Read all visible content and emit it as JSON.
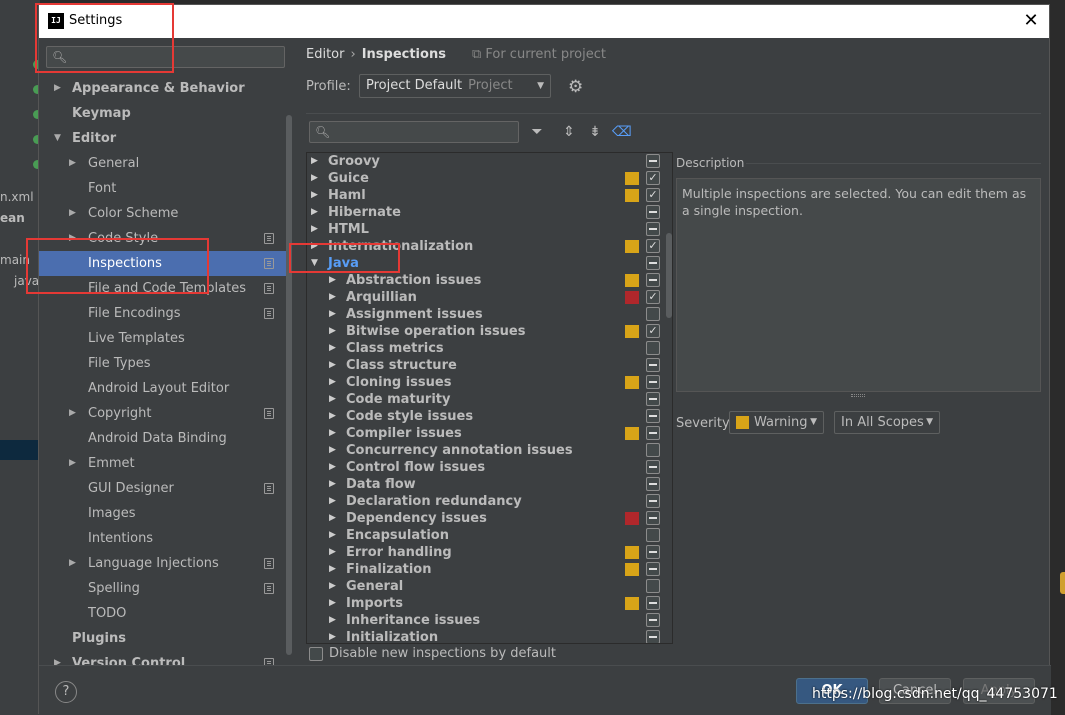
{
  "background_ide": {
    "texts": [
      "n.xml",
      "ean",
      "main",
      "java"
    ]
  },
  "window": {
    "title": "Settings",
    "app_icon_text": "IJ",
    "close_glyph": "✕"
  },
  "search": {
    "placeholder": "",
    "icon_glyph": "🔍︎"
  },
  "sidebar": {
    "items": [
      {
        "label": "Appearance & Behavior",
        "arrow": "▶"
      },
      {
        "label": "Keymap",
        "arrow": ""
      },
      {
        "label": "Editor",
        "arrow": "▼"
      },
      {
        "label": "General",
        "arrow": "▶"
      },
      {
        "label": "Font",
        "arrow": ""
      },
      {
        "label": "Color Scheme",
        "arrow": "▶"
      },
      {
        "label": "Code Style",
        "arrow": "▶"
      },
      {
        "label": "Inspections",
        "arrow": ""
      },
      {
        "label": "File and Code Templates",
        "arrow": ""
      },
      {
        "label": "File Encodings",
        "arrow": ""
      },
      {
        "label": "Live Templates",
        "arrow": ""
      },
      {
        "label": "File Types",
        "arrow": ""
      },
      {
        "label": "Android Layout Editor",
        "arrow": ""
      },
      {
        "label": "Copyright",
        "arrow": "▶"
      },
      {
        "label": "Android Data Binding",
        "arrow": ""
      },
      {
        "label": "Emmet",
        "arrow": "▶"
      },
      {
        "label": "GUI Designer",
        "arrow": ""
      },
      {
        "label": "Images",
        "arrow": ""
      },
      {
        "label": "Intentions",
        "arrow": ""
      },
      {
        "label": "Language Injections",
        "arrow": "▶"
      },
      {
        "label": "Spelling",
        "arrow": ""
      },
      {
        "label": "TODO",
        "arrow": ""
      },
      {
        "label": "Plugins",
        "arrow": ""
      },
      {
        "label": "Version Control",
        "arrow": "▶"
      }
    ]
  },
  "header": {
    "breadcrumb_parent": "Editor",
    "breadcrumb_sep": "›",
    "breadcrumb_current": "Inspections",
    "project_hint": "⧉ For current project",
    "profile_label": "Profile:",
    "profile_value": "Project Default",
    "profile_sub": "Project",
    "dropdown_glyph": "▼",
    "gear_glyph": "⚙"
  },
  "toolbar": {
    "filter_glyph": "⏷",
    "expand_glyph": "⇕",
    "collapse_glyph": "⇟",
    "eraser_glyph": "⌫"
  },
  "inspections": {
    "items": [
      {
        "label": "Groovy",
        "arrow": "▶",
        "severity": "",
        "check": "indet"
      },
      {
        "label": "Guice",
        "arrow": "▶",
        "severity": "#d8a418",
        "check": "checked"
      },
      {
        "label": "Haml",
        "arrow": "▶",
        "severity": "#d8a418",
        "check": "checked"
      },
      {
        "label": "Hibernate",
        "arrow": "▶",
        "severity": "",
        "check": "indet"
      },
      {
        "label": "HTML",
        "arrow": "▶",
        "severity": "",
        "check": "indet"
      },
      {
        "label": "Internationalization",
        "arrow": "▶",
        "severity": "#d8a418",
        "check": "checked"
      },
      {
        "label": "Java",
        "arrow": "▼",
        "severity": "",
        "check": "indet"
      },
      {
        "label": "Abstraction issues",
        "arrow": "▶",
        "severity": "#d8a418",
        "check": "indet"
      },
      {
        "label": "Arquillian",
        "arrow": "▶",
        "severity": "#b0272b",
        "check": "checked"
      },
      {
        "label": "Assignment issues",
        "arrow": "▶",
        "severity": "",
        "check": "empty"
      },
      {
        "label": "Bitwise operation issues",
        "arrow": "▶",
        "severity": "#d8a418",
        "check": "checked"
      },
      {
        "label": "Class metrics",
        "arrow": "▶",
        "severity": "",
        "check": "empty"
      },
      {
        "label": "Class structure",
        "arrow": "▶",
        "severity": "",
        "check": "indet"
      },
      {
        "label": "Cloning issues",
        "arrow": "▶",
        "severity": "#d8a418",
        "check": "indet"
      },
      {
        "label": "Code maturity",
        "arrow": "▶",
        "severity": "",
        "check": "indet"
      },
      {
        "label": "Code style issues",
        "arrow": "▶",
        "severity": "",
        "check": "indet"
      },
      {
        "label": "Compiler issues",
        "arrow": "▶",
        "severity": "#d8a418",
        "check": "indet"
      },
      {
        "label": "Concurrency annotation issues",
        "arrow": "▶",
        "severity": "",
        "check": "empty"
      },
      {
        "label": "Control flow issues",
        "arrow": "▶",
        "severity": "",
        "check": "indet"
      },
      {
        "label": "Data flow",
        "arrow": "▶",
        "severity": "",
        "check": "indet"
      },
      {
        "label": "Declaration redundancy",
        "arrow": "▶",
        "severity": "",
        "check": "indet"
      },
      {
        "label": "Dependency issues",
        "arrow": "▶",
        "severity": "#b0272b",
        "check": "indet"
      },
      {
        "label": "Encapsulation",
        "arrow": "▶",
        "severity": "",
        "check": "empty"
      },
      {
        "label": "Error handling",
        "arrow": "▶",
        "severity": "#d8a418",
        "check": "indet"
      },
      {
        "label": "Finalization",
        "arrow": "▶",
        "severity": "#d8a418",
        "check": "indet"
      },
      {
        "label": "General",
        "arrow": "▶",
        "severity": "",
        "check": "empty"
      },
      {
        "label": "Imports",
        "arrow": "▶",
        "severity": "#d8a418",
        "check": "indet"
      },
      {
        "label": "Inheritance issues",
        "arrow": "▶",
        "severity": "",
        "check": "indet"
      },
      {
        "label": "Initialization",
        "arrow": "▶",
        "severity": "",
        "check": "indet"
      }
    ]
  },
  "description": {
    "label": "Description",
    "text": "Multiple inspections are selected. You can edit them as a single inspection."
  },
  "severity": {
    "label": "Severity:",
    "value": "Warning",
    "color": "#d8a418",
    "scope": "In All Scopes"
  },
  "disable_checkbox_label": "Disable new inspections by default",
  "footer": {
    "help": "?",
    "ok": "OK",
    "cancel": "Cancel",
    "apply": "Apply"
  },
  "watermark": "https://blog.csdn.net/qq_44753071",
  "colors": {
    "selection": "#4b6eaf",
    "accent_link": "#589df6",
    "annotation_red": "#e53935",
    "warning": "#d8a418",
    "error": "#b0272b"
  }
}
